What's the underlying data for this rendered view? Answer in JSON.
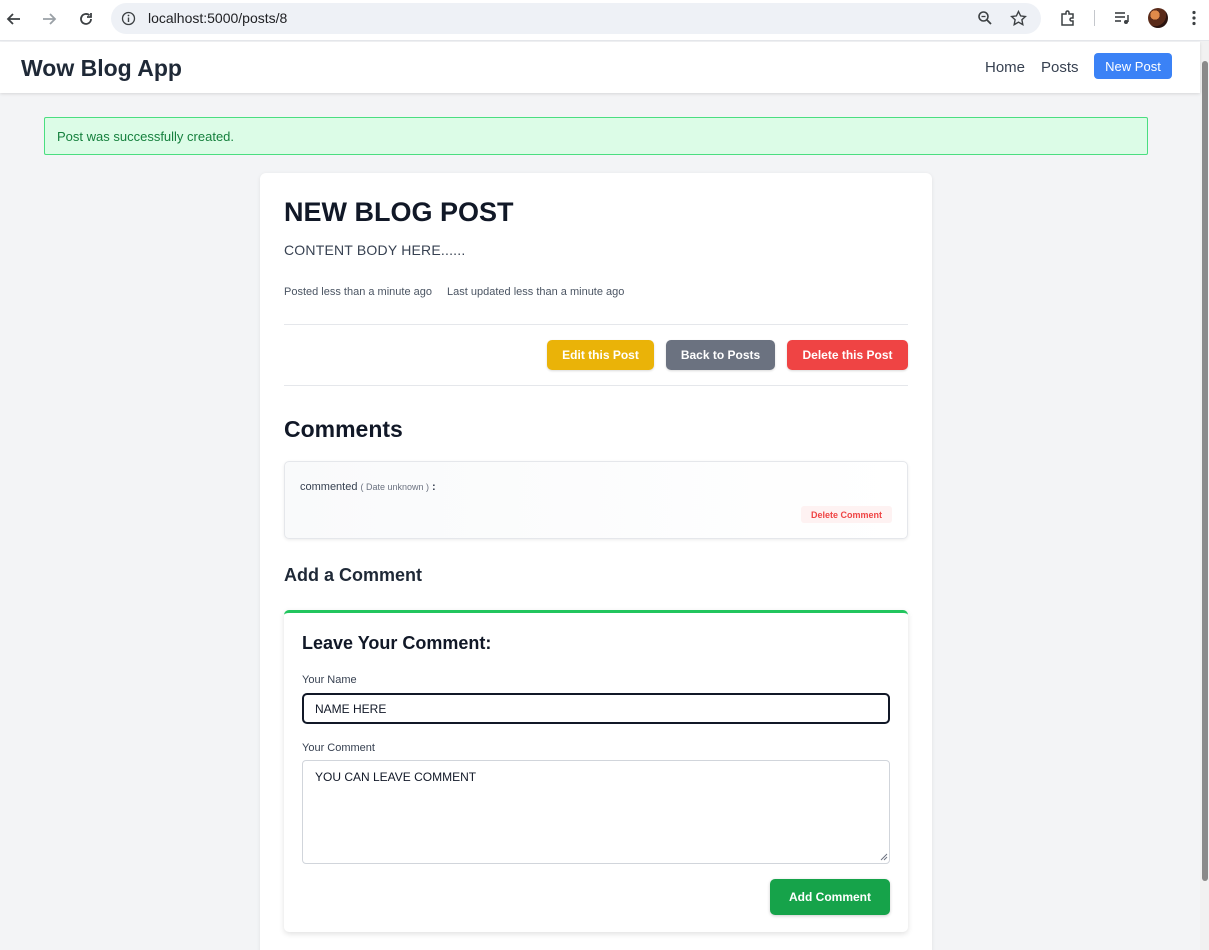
{
  "browser": {
    "url": "localhost:5000/posts/8"
  },
  "header": {
    "brand": "Wow Blog App",
    "nav": {
      "home": "Home",
      "posts": "Posts",
      "new_post": "New Post"
    }
  },
  "flash": {
    "message": "Post was successfully created."
  },
  "post": {
    "title": "NEW BLOG POST",
    "body": "CONTENT BODY HERE......",
    "posted": "Posted less than a minute ago",
    "updated": "Last updated less than a minute ago",
    "actions": {
      "edit": "Edit this Post",
      "back": "Back to Posts",
      "delete": "Delete this Post"
    }
  },
  "comments": {
    "title": "Comments",
    "items": [
      {
        "text": "commented",
        "date": "( Date unknown )",
        "colon": ":",
        "delete_label": "Delete Comment"
      }
    ]
  },
  "add_comment": {
    "title": "Add a Comment",
    "form_title": "Leave Your Comment:",
    "name_label": "Your Name",
    "name_value": "NAME HERE",
    "comment_label": "Your Comment",
    "comment_value": "YOU CAN LEAVE COMMENT",
    "submit": "Add Comment"
  },
  "colors": {
    "primary": "#3b82f6",
    "edit": "#eab308",
    "back": "#6b7280",
    "delete": "#ef4444",
    "success": "#16a34a"
  }
}
